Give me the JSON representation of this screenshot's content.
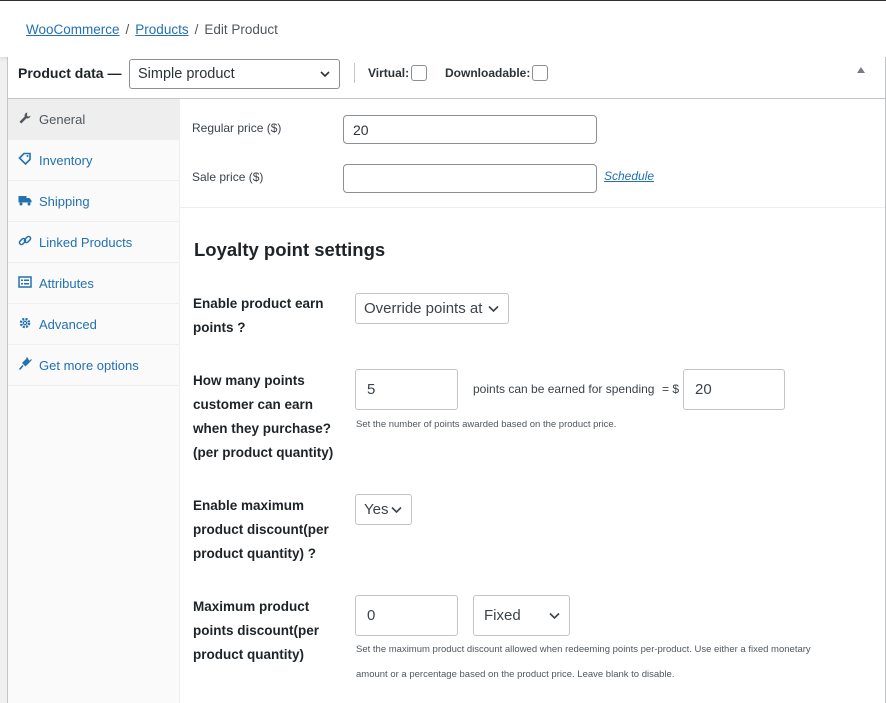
{
  "breadcrumb": {
    "items": [
      "WooCommerce",
      "Products"
    ],
    "current": "Edit Product",
    "separator": "/"
  },
  "product_data": {
    "title": "Product data —",
    "type_select": "Simple product",
    "virtual_label": "Virtual:",
    "downloadable_label": "Downloadable:"
  },
  "sidebar": {
    "tabs": [
      {
        "label": "General",
        "icon": "wrench-icon"
      },
      {
        "label": "Inventory",
        "icon": "tag-icon"
      },
      {
        "label": "Shipping",
        "icon": "truck-icon"
      },
      {
        "label": "Linked Products",
        "icon": "link-icon"
      },
      {
        "label": "Attributes",
        "icon": "list-icon"
      },
      {
        "label": "Advanced",
        "icon": "gear-icon"
      },
      {
        "label": "Get more options",
        "icon": "plugin-icon"
      }
    ]
  },
  "general": {
    "regular_price_label": "Regular price ($)",
    "regular_price_value": "20",
    "sale_price_label": "Sale price ($)",
    "sale_price_value": "",
    "schedule_link": "Schedule"
  },
  "loyalty": {
    "title": "Loyalty point settings",
    "earn": {
      "label_lines": [
        "Enable product earn",
        "points ?"
      ],
      "select": "Override points at"
    },
    "points": {
      "label_lines": [
        "How many points",
        "customer can earn",
        "when they purchase?",
        "(per product quantity)"
      ],
      "points_value": "5",
      "middle_text": "points can be earned for spending",
      "equals_text": "= $",
      "spend_value": "20",
      "description": "Set the number of points awarded based on the product price."
    },
    "max_discount_enable": {
      "label_lines": [
        "Enable maximum",
        "product discount(per",
        "product quantity) ?"
      ],
      "select": "Yes"
    },
    "max_discount": {
      "label_lines": [
        "Maximum product",
        "points discount(per",
        "product quantity)"
      ],
      "value": "0",
      "type_select": "Fixed",
      "description_lines": [
        "Set the maximum product discount allowed when redeeming points per-product. Use either a fixed monetary",
        "amount or a percentage based on the product price. Leave blank to disable."
      ]
    }
  },
  "colors": {
    "link": "#2271b1",
    "text": "#1d2327",
    "border": "#8c8f94"
  }
}
